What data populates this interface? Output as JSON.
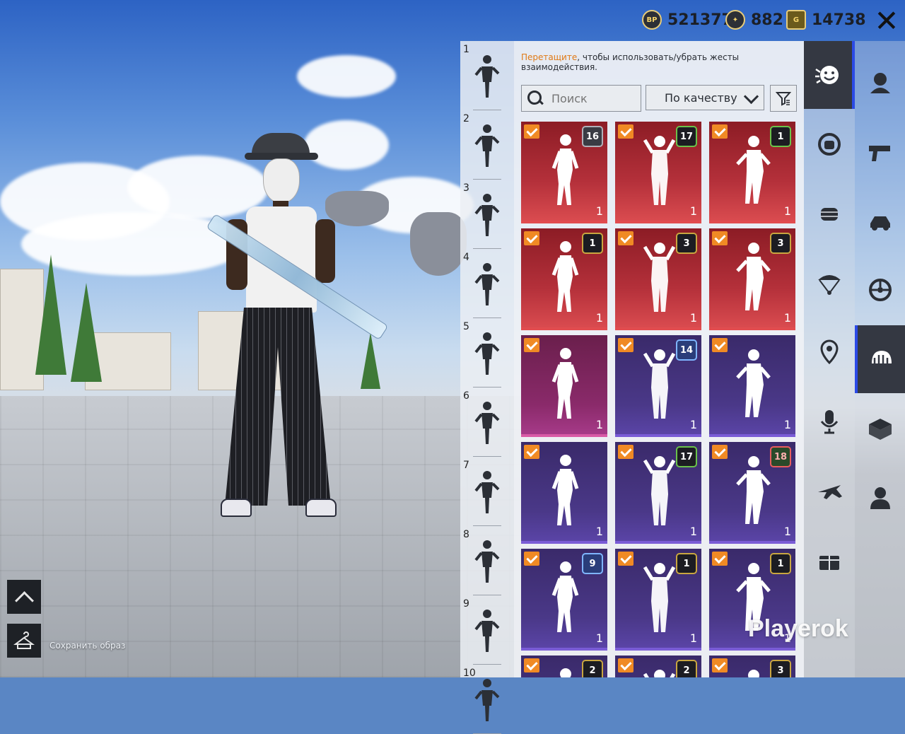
{
  "currency": [
    {
      "icon": "bp-coin-icon",
      "label": "BP",
      "value": "521377"
    },
    {
      "icon": "silver-fragment-icon",
      "label": "",
      "value": "882"
    },
    {
      "icon": "uc-gold-icon",
      "label": "G",
      "value": "14738"
    }
  ],
  "close_label": "✕",
  "hint": {
    "highlight": "Перетащите",
    "rest": ", чтобы использовать/убрать жесты взаимодействия."
  },
  "search": {
    "placeholder": "Поиск"
  },
  "sort": {
    "label": "По качеству"
  },
  "slots": [
    "1",
    "2",
    "3",
    "4",
    "5",
    "6",
    "7",
    "8",
    "9",
    "10"
  ],
  "cards": [
    {
      "rarity": "red",
      "badge": "16",
      "badge_color": "gray",
      "count": "1"
    },
    {
      "rarity": "red",
      "badge": "17",
      "badge_color": "green",
      "count": "1"
    },
    {
      "rarity": "red",
      "badge": "1",
      "badge_color": "green",
      "count": "1"
    },
    {
      "rarity": "red",
      "badge": "1",
      "badge_color": "",
      "count": "1"
    },
    {
      "rarity": "red",
      "badge": "3",
      "badge_color": "",
      "count": "1"
    },
    {
      "rarity": "red",
      "badge": "3",
      "badge_color": "",
      "count": "1"
    },
    {
      "rarity": "pink",
      "badge": "",
      "badge_color": "",
      "count": "1"
    },
    {
      "rarity": "purple",
      "badge": "14",
      "badge_color": "blue",
      "count": "1"
    },
    {
      "rarity": "purple",
      "badge": "",
      "badge_color": "",
      "count": "1"
    },
    {
      "rarity": "purple",
      "badge": "",
      "badge_color": "",
      "count": "1"
    },
    {
      "rarity": "purple",
      "badge": "17",
      "badge_color": "green",
      "count": "1"
    },
    {
      "rarity": "purple",
      "badge": "18",
      "badge_color": "red",
      "count": "1"
    },
    {
      "rarity": "purple",
      "badge": "9",
      "badge_color": "blue",
      "count": "1"
    },
    {
      "rarity": "purple",
      "badge": "1",
      "badge_color": "",
      "count": "1"
    },
    {
      "rarity": "purple",
      "badge": "1",
      "badge_color": "",
      "count": "1"
    },
    {
      "rarity": "purple",
      "badge": "2",
      "badge_color": "",
      "count": ""
    },
    {
      "rarity": "purple",
      "badge": "2",
      "badge_color": "",
      "count": ""
    },
    {
      "rarity": "purple",
      "badge": "3",
      "badge_color": "",
      "count": ""
    }
  ],
  "tabs_left": [
    "emote-face-icon",
    "wheel-emote-icon",
    "fist-icon",
    "parachute-icon",
    "location-pin-icon",
    "microphone-icon",
    "plane-icon",
    "gift-box-icon"
  ],
  "tabs_right": [
    "avatar-icon",
    "pistol-icon",
    "vehicle-icon",
    "wheel-icon",
    "helmet-icon",
    "crate-icon",
    "character-icon"
  ],
  "save_label": "Сохранить образ",
  "watermark": "Playerok",
  "colors": {
    "accent": "#f08a24",
    "active_tab": "#343842",
    "active_bar": "#2b4ae6"
  }
}
